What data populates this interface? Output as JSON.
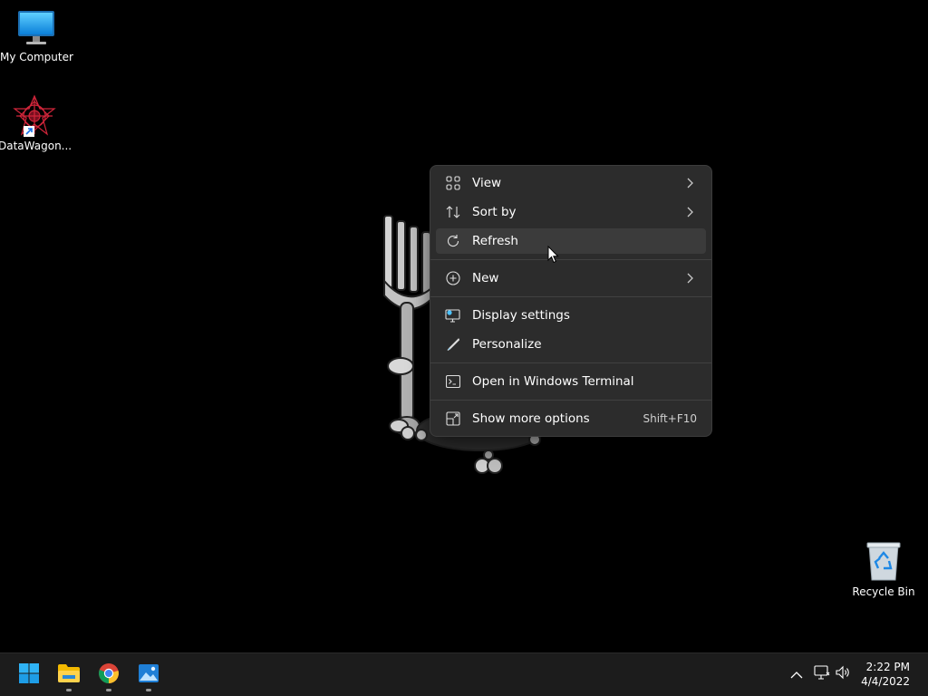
{
  "desktop": {
    "icons": [
      {
        "label": "My Computer",
        "icon": "monitor-icon"
      },
      {
        "label": "DataWagon...",
        "icon": "datawagon-icon"
      },
      {
        "label": "Recycle Bin",
        "icon": "recycle-bin-icon"
      }
    ]
  },
  "context_menu": {
    "items": [
      {
        "label": "View",
        "icon": "view-grid-icon",
        "submenu": true
      },
      {
        "label": "Sort by",
        "icon": "sort-icon",
        "submenu": true
      },
      {
        "label": "Refresh",
        "icon": "refresh-icon",
        "hovered": true
      },
      {
        "label": "New",
        "icon": "new-plus-icon",
        "submenu": true
      },
      {
        "label": "Display settings",
        "icon": "display-settings-icon"
      },
      {
        "label": "Personalize",
        "icon": "pen-icon"
      },
      {
        "label": "Open in Windows Terminal",
        "icon": "terminal-icon"
      },
      {
        "label": "Show more options",
        "icon": "more-options-icon",
        "shortcut": "Shift+F10"
      }
    ]
  },
  "taskbar": {
    "apps": [
      {
        "name": "Start",
        "icon": "windows-start-icon"
      },
      {
        "name": "File Explorer",
        "icon": "folder-icon"
      },
      {
        "name": "Google Chrome",
        "icon": "chrome-icon"
      },
      {
        "name": "Photos",
        "icon": "photos-icon"
      }
    ],
    "tray": [
      "chevron-up-icon",
      "network-icon",
      "volume-icon"
    ],
    "clock": {
      "time": "2:22 PM",
      "date": "4/4/2022"
    }
  },
  "colors": {
    "desktop_bg": "#000000",
    "menu_bg": "#2c2c2c",
    "menu_hover": "#3b3b3b",
    "taskbar_bg": "#1c1c1c",
    "accent": "#0078d4"
  }
}
